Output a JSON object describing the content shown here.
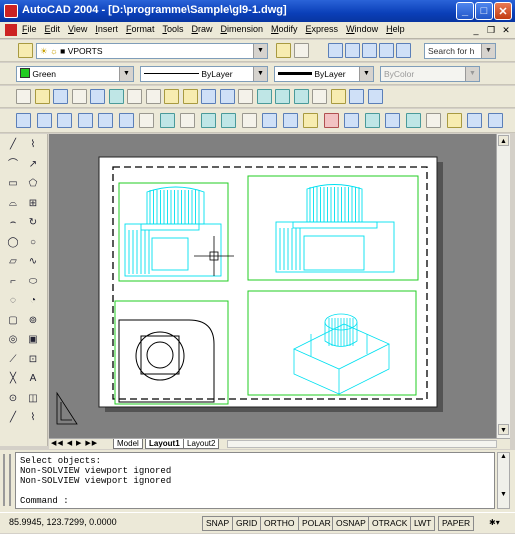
{
  "window": {
    "title": "AutoCAD 2004 - [D:\\programme\\Sample\\gl9-1.dwg]"
  },
  "menu": [
    "File",
    "Edit",
    "View",
    "Insert",
    "Format",
    "Tools",
    "Draw",
    "Dimension",
    "Modify",
    "Express",
    "Window",
    "Help"
  ],
  "layers_toolbar": {
    "layer": "VPORTS",
    "search_placeholder": "Search for h"
  },
  "properties_toolbar": {
    "color": "Green",
    "linetype": "ByLayer",
    "lineweight": "ByLayer",
    "plotstyle": "ByColor"
  },
  "layout_tabs": [
    "Model",
    "Layout1",
    "Layout2"
  ],
  "command_lines": [
    "Select objects:",
    "Non-SOLVIEW viewport ignored",
    "Non-SOLVIEW viewport ignored"
  ],
  "command_prompt": "Command :",
  "status": {
    "coordinates": "85.9945, 123.7299, 0.0000",
    "toggles": [
      "SNAP",
      "GRID",
      "ORTHO",
      "POLAR",
      "OSNAP",
      "OTRACK",
      "LWT",
      "PAPER"
    ]
  },
  "colors": {
    "accent": "#0a3fb8",
    "drawing_line": "#00e0f0",
    "viewport_border": "#22cc22"
  }
}
